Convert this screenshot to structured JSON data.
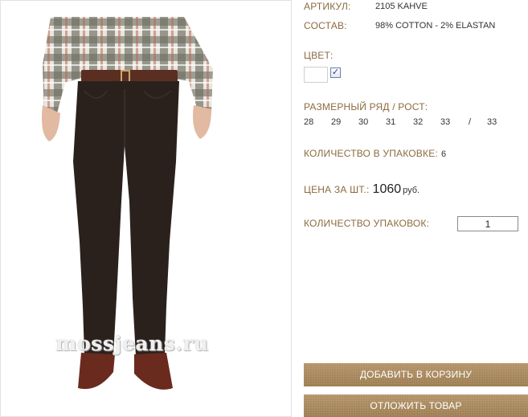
{
  "image": {
    "watermark": "mossjeans.ru"
  },
  "product": {
    "article_label": "АРТИКУЛ:",
    "article_value": "2105 KAHVE",
    "composition_label": "СОСТАВ:",
    "composition_value": "98% COTTON - 2% ELASTAN",
    "color_label": "ЦВЕТ:",
    "color_checked": true,
    "sizes_label": "РАЗМЕРНЫЙ РЯД / РОСТ:",
    "sizes": [
      "28",
      "29",
      "30",
      "31",
      "32",
      "33",
      "/",
      "33"
    ],
    "pack_qty_label": "КОЛИЧЕСТВО В УПАКОВКЕ:",
    "pack_qty_value": "6",
    "price_label": "ЦЕНА ЗА ШТ.:",
    "price_value": "1060",
    "price_unit": "руб.",
    "packs_label": "КОЛИЧЕСТВО УПАКОВОК:",
    "packs_value": "1"
  },
  "actions": {
    "add_to_cart": "ДОБАВИТЬ В КОРЗИНУ",
    "postpone": "ОТЛОЖИТЬ ТОВАР"
  },
  "colors": {
    "label": "#8b6b3f",
    "button": "#a9895c",
    "jeans": "#2b211c"
  }
}
